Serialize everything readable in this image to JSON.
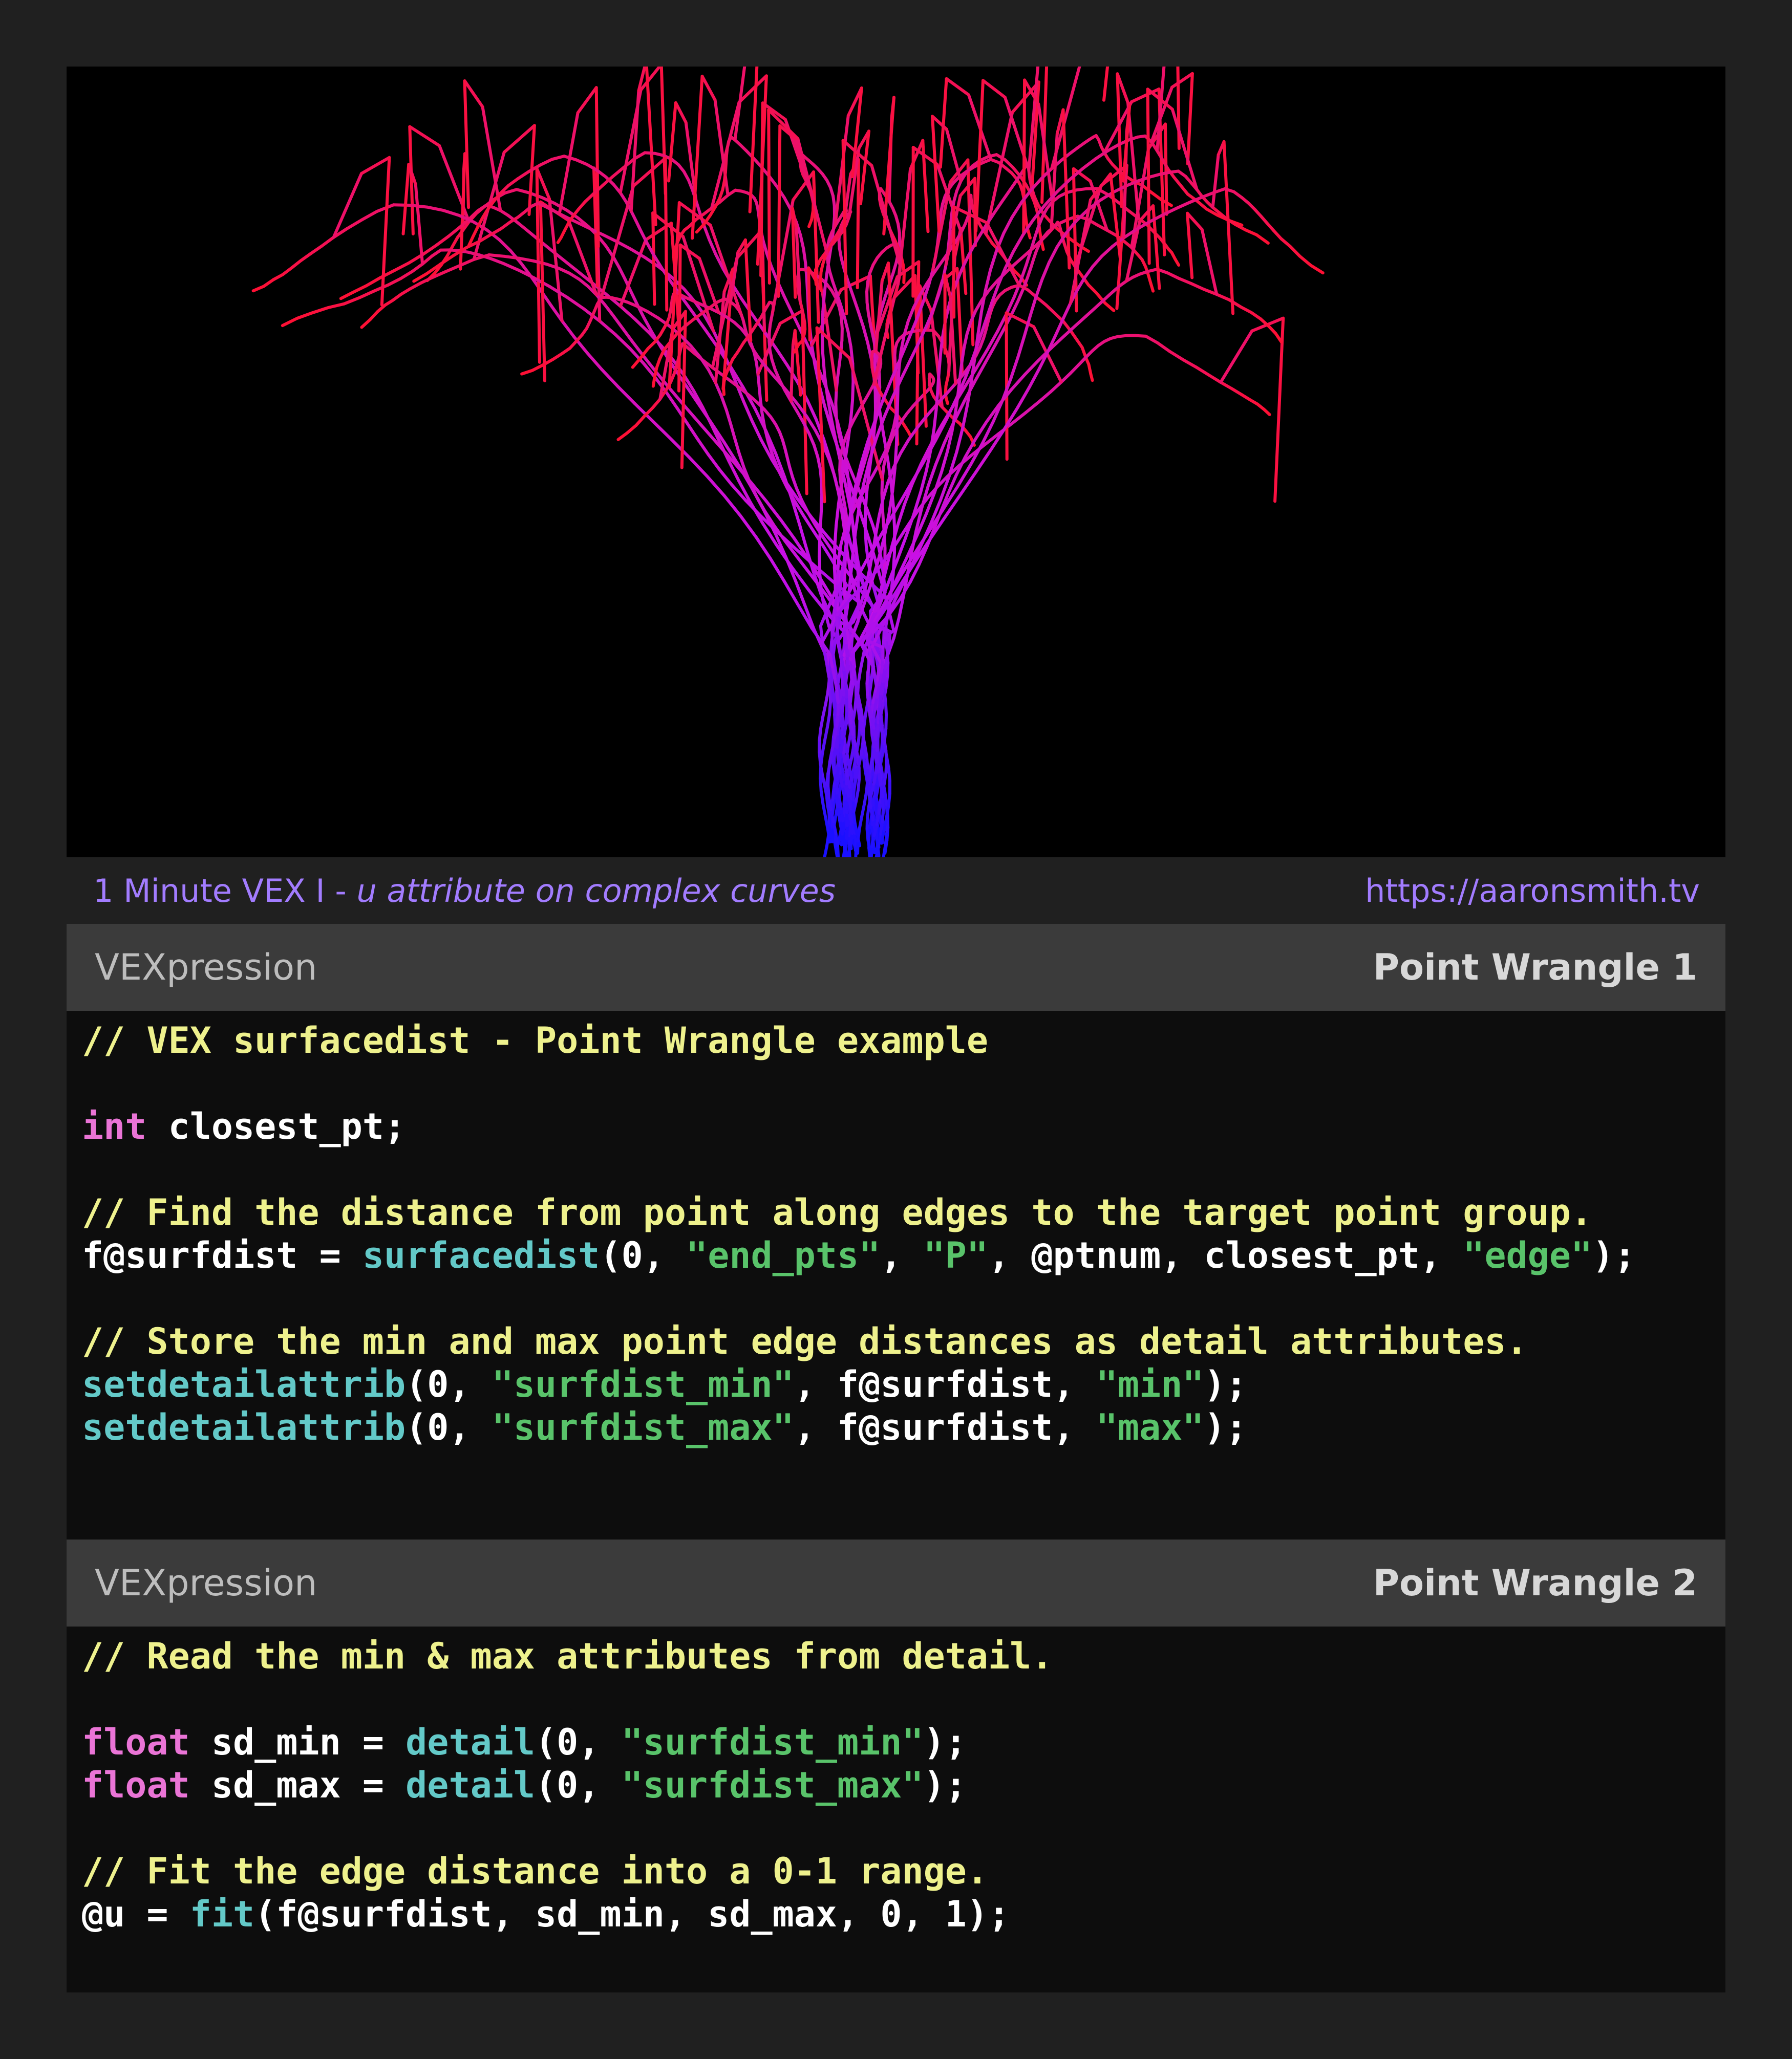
{
  "caption": {
    "series": "1 Minute VEX I - ",
    "subtitle": "u attribute on complex curves",
    "url": "https://aaronsmith.tv"
  },
  "panels": [
    {
      "label": "VEXpression",
      "node": "Point Wrangle 1",
      "lines": [
        [
          {
            "t": "// VEX surfacedist - Point Wrangle example",
            "c": "c"
          }
        ],
        [],
        [
          {
            "t": "int",
            "c": "k"
          },
          {
            "t": " closest_pt;"
          }
        ],
        [],
        [
          {
            "t": "// Find the distance from point along edges to the target point group.",
            "c": "c"
          }
        ],
        [
          {
            "t": "f@surfdist = "
          },
          {
            "t": "surfacedist",
            "c": "f"
          },
          {
            "t": "(0, "
          },
          {
            "t": "\"end_pts\"",
            "c": "s"
          },
          {
            "t": ", "
          },
          {
            "t": "\"P\"",
            "c": "s"
          },
          {
            "t": ", @ptnum, closest_pt, "
          },
          {
            "t": "\"edge\"",
            "c": "s"
          },
          {
            "t": ");"
          }
        ],
        [],
        [
          {
            "t": "// Store the min and max point edge distances as detail attributes.",
            "c": "c"
          }
        ],
        [
          {
            "t": "setdetailattrib",
            "c": "f"
          },
          {
            "t": "(0, "
          },
          {
            "t": "\"surfdist_min\"",
            "c": "s"
          },
          {
            "t": ", f@surfdist, "
          },
          {
            "t": "\"min\"",
            "c": "s"
          },
          {
            "t": ");"
          }
        ],
        [
          {
            "t": "setdetailattrib",
            "c": "f"
          },
          {
            "t": "(0, "
          },
          {
            "t": "\"surfdist_max\"",
            "c": "s"
          },
          {
            "t": ", f@surfdist, "
          },
          {
            "t": "\"max\"",
            "c": "s"
          },
          {
            "t": ");"
          }
        ]
      ]
    },
    {
      "label": "VEXpression",
      "node": "Point Wrangle 2",
      "lines": [
        [
          {
            "t": "// Read the min & max attributes from detail.",
            "c": "c"
          }
        ],
        [],
        [
          {
            "t": "float",
            "c": "k"
          },
          {
            "t": " sd_min = "
          },
          {
            "t": "detail",
            "c": "f"
          },
          {
            "t": "(0, "
          },
          {
            "t": "\"surfdist_min\"",
            "c": "s"
          },
          {
            "t": ");"
          }
        ],
        [
          {
            "t": "float",
            "c": "k"
          },
          {
            "t": " sd_max = "
          },
          {
            "t": "detail",
            "c": "f"
          },
          {
            "t": "(0, "
          },
          {
            "t": "\"surfdist_max\"",
            "c": "s"
          },
          {
            "t": ");"
          }
        ],
        [],
        [
          {
            "t": "// Fit the edge distance into a 0-1 range.",
            "c": "c"
          }
        ],
        [
          {
            "t": "@u = "
          },
          {
            "t": "fit",
            "c": "f"
          },
          {
            "t": "(f@surfdist, sd_min, sd_max, 0, 1);"
          }
        ]
      ]
    }
  ],
  "colors": {
    "comment": "#eef18d",
    "keyword": "#ea74d6",
    "function": "#63c9c8",
    "string": "#59c36a",
    "caption": "#a27cff",
    "curve_root": "#1a10ff",
    "curve_tip": "#ff1030"
  }
}
